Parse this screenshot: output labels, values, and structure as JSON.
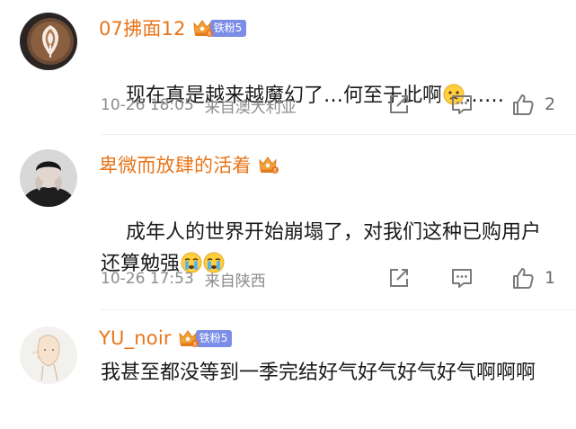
{
  "comments": [
    {
      "username": "07拂面12",
      "fan_badge": "铁粉5",
      "text": "现在真是越来越魔幻了…何至于此啊",
      "text_suffix": "……",
      "time": "10-26 18:05",
      "location": "来自澳大利亚",
      "likes": "2"
    },
    {
      "username": "卑微而放肆的活着",
      "fan_badge": "",
      "text": "成年人的世界开始崩塌了，对我们这种已购用户还算勉强",
      "time": "10-26 17:53",
      "location": "来自陕西",
      "likes": "1"
    },
    {
      "username": "YU_noir",
      "fan_badge": "铁粉5",
      "text": "我甚至都没等到一季完结好气好气好气好气啊啊啊"
    }
  ],
  "colors": {
    "username": "#e8751a",
    "fan_badge_bg": "#7b8de6",
    "meta_gray": "#8c8c8c"
  },
  "icons": {
    "repost": "repost-icon",
    "reply": "reply-icon",
    "like": "like-icon",
    "crown": "crown-badge-icon"
  }
}
